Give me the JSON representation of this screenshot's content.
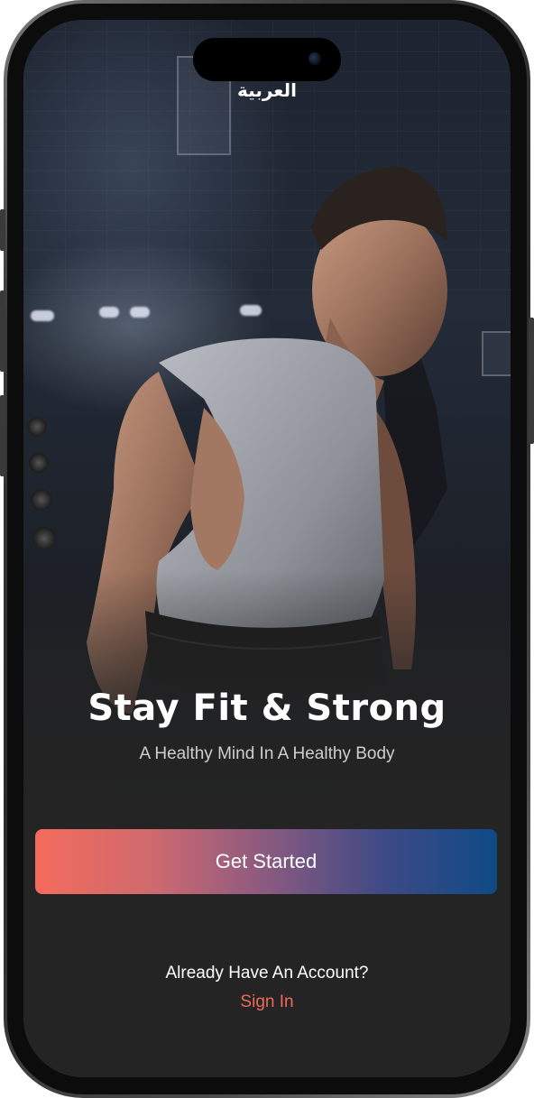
{
  "header": {
    "language_toggle": "العربية"
  },
  "hero": {
    "image_icon": "athlete-photo",
    "title": "Stay Fit & Strong",
    "subtitle": "A Healthy Mind In A Healthy Body"
  },
  "actions": {
    "get_started_label": "Get Started",
    "account_prompt": "Already Have An Account?",
    "sign_in_label": "Sign In"
  },
  "colors": {
    "accent": "#F46B5C",
    "gradient_end": "#0F4A86",
    "background": "#242424"
  }
}
